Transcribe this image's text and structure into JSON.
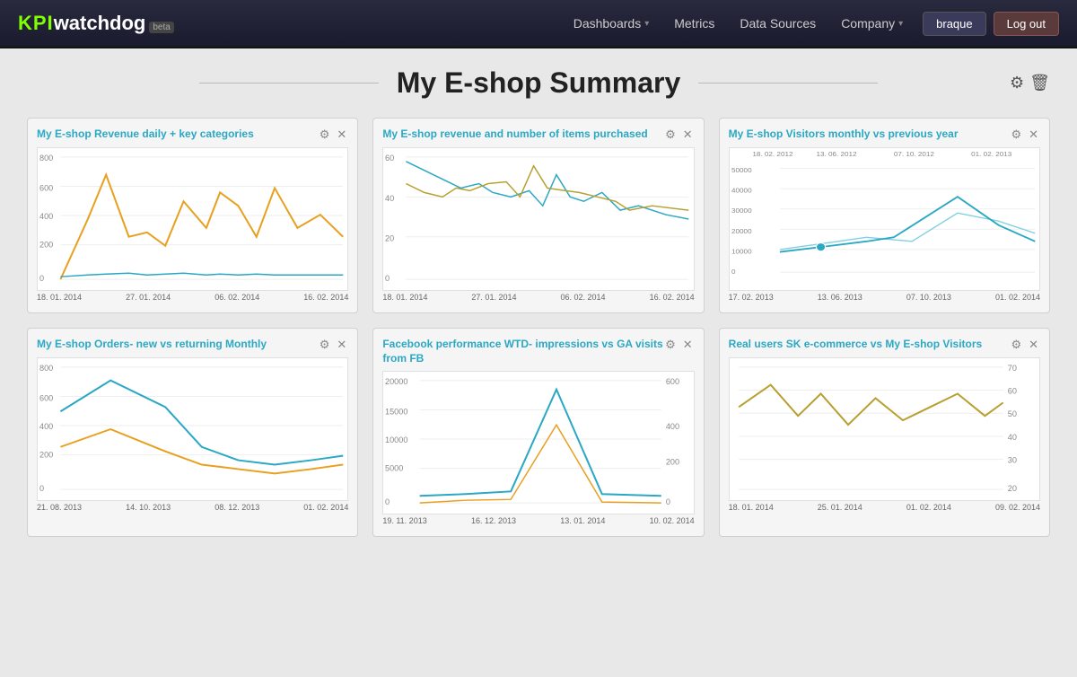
{
  "nav": {
    "logo_kpi": "KPI",
    "logo_watchdog": "watchdog",
    "logo_beta": "beta",
    "links": [
      {
        "label": "Dashboards",
        "has_arrow": true
      },
      {
        "label": "Metrics",
        "has_arrow": false
      },
      {
        "label": "Data Sources",
        "has_arrow": false
      },
      {
        "label": "Company",
        "has_arrow": true
      }
    ],
    "user_btn": "braque",
    "logout_btn": "Log out"
  },
  "page": {
    "title": "My E-shop Summary",
    "gear_icon": "⚙",
    "trash_icon": "🗑"
  },
  "widgets": [
    {
      "title": "My E-shop Revenue daily + key categories",
      "x_labels": [
        "18. 01. 2014",
        "27. 01. 2014",
        "06. 02. 2014",
        "16. 02. 2014"
      ],
      "y_labels": [
        "800",
        "600",
        "400",
        "200",
        "0"
      ]
    },
    {
      "title": "My E-shop revenue and number of items purchased",
      "x_labels": [
        "18. 01. 2014",
        "27. 01. 2014",
        "06. 02. 2014",
        "16. 02. 2014"
      ],
      "y_labels": [
        "60",
        "40",
        "20",
        "0"
      ]
    },
    {
      "title": "My E-shop Visitors monthly vs previous year",
      "x_labels_top": [
        "18. 02. 2012",
        "13. 06. 2012",
        "07. 10. 2012",
        "01. 02. 2013"
      ],
      "x_labels": [
        "17. 02. 2013",
        "13. 06. 2013",
        "07. 10. 2013",
        "01. 02. 2014"
      ],
      "y_labels": [
        "50000",
        "40000",
        "30000",
        "20000",
        "10000",
        "0"
      ]
    },
    {
      "title": "My E-shop Orders- new vs returning Monthly",
      "x_labels": [
        "21. 08. 2013",
        "14. 10. 2013",
        "08. 12. 2013",
        "01. 02. 2014"
      ],
      "y_labels": [
        "800",
        "600",
        "400",
        "200",
        "0"
      ]
    },
    {
      "title": "Facebook performance WTD- impressions vs GA visits from FB",
      "x_labels": [
        "19. 11. 2013",
        "16. 12. 2013",
        "13. 01. 2014",
        "10. 02. 2014"
      ],
      "y_labels_left": [
        "20000",
        "15000",
        "10000",
        "5000",
        "0"
      ],
      "y_labels_right": [
        "600",
        "400",
        "200",
        "0"
      ]
    },
    {
      "title": "Real users SK e-commerce vs My E-shop Visitors",
      "x_labels": [
        "18. 01. 2014",
        "25. 01. 2014",
        "01. 02. 2014",
        "09. 02. 2014"
      ],
      "y_labels_right": [
        "70",
        "60",
        "50",
        "40",
        "30",
        "20"
      ]
    }
  ]
}
